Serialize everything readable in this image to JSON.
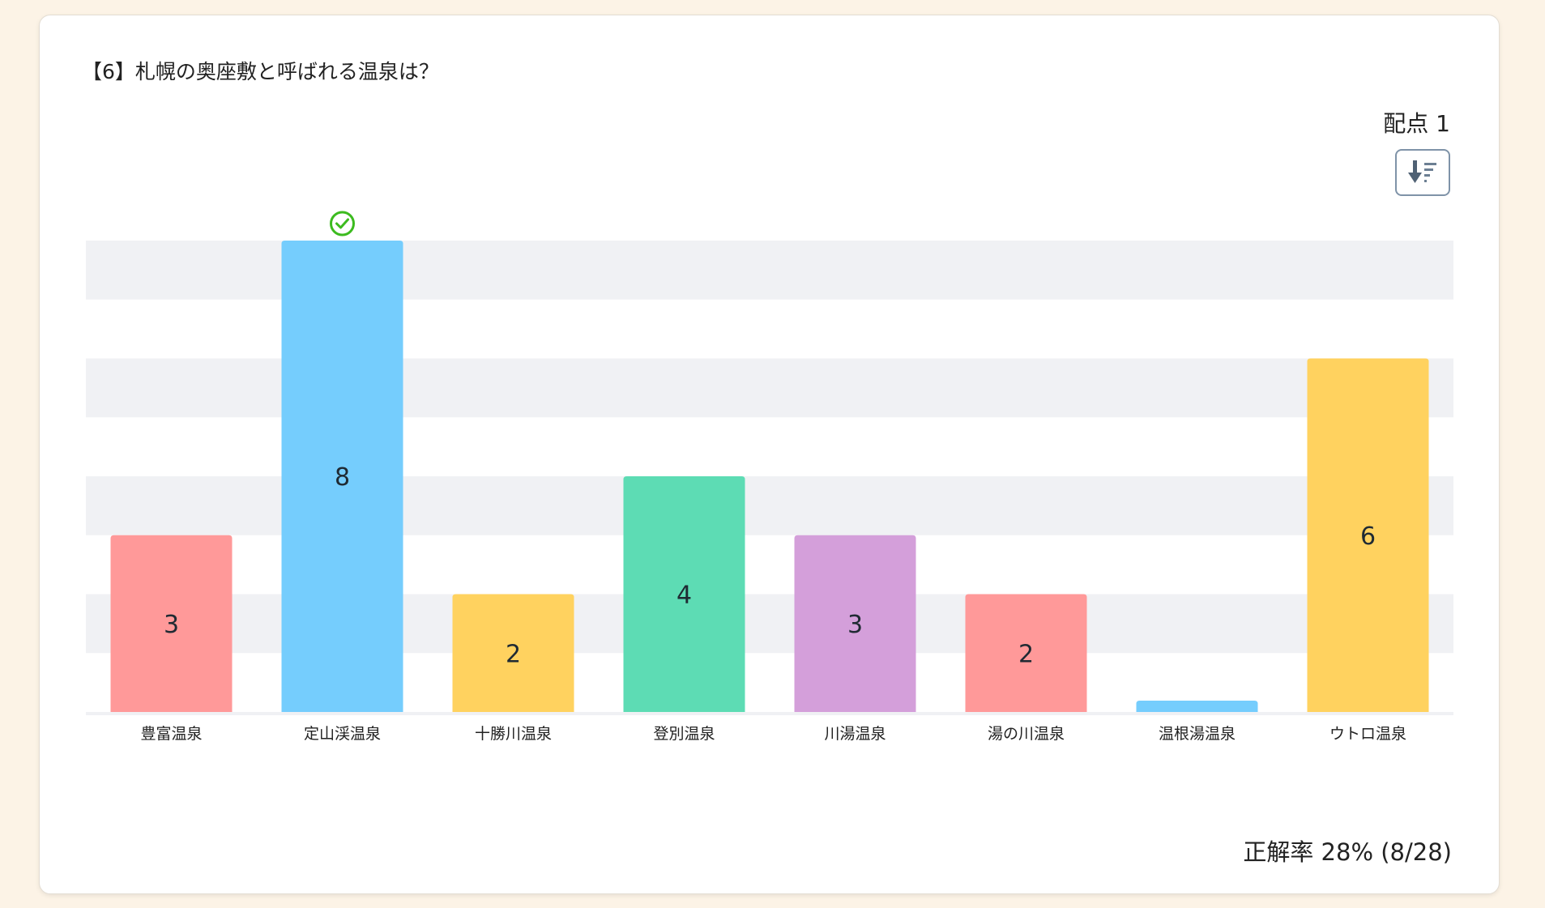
{
  "question": {
    "title": "【6】札幌の奥座敷と呼ばれる温泉は？",
    "points_label": "配点 1"
  },
  "icons": {
    "sort": "sort-descending-icon",
    "correct": "check-circle-icon"
  },
  "colors": {
    "red": "#ff9999",
    "blue": "#75cdfd",
    "yellow": "#ffd25f",
    "green": "#5ddcb4",
    "purple": "#d49fda",
    "correct": "#3cbb1f",
    "band": "#f0f1f4"
  },
  "chart_data": {
    "type": "bar",
    "categories": [
      "豊富温泉",
      "定山渓温泉",
      "十勝川温泉",
      "登別温泉",
      "川湯温泉",
      "湯の川温泉",
      "温根湯温泉",
      "ウトロ温泉"
    ],
    "values": [
      3,
      8,
      2,
      4,
      3,
      2,
      0,
      6
    ],
    "data_labels": [
      "3",
      "8",
      "2",
      "4",
      "3",
      "2",
      "",
      "6"
    ],
    "bar_colors": [
      "#ff9999",
      "#75cdfd",
      "#ffd25f",
      "#5ddcb4",
      "#d49fda",
      "#ff9999",
      "#75cdfd",
      "#ffd25f"
    ],
    "correct_index": 1,
    "ylim": [
      0,
      8
    ],
    "grid": "alternating-bands",
    "title": "",
    "xlabel": "",
    "ylabel": ""
  },
  "summary": {
    "accuracy_label": "正解率 28% (8/28)"
  }
}
